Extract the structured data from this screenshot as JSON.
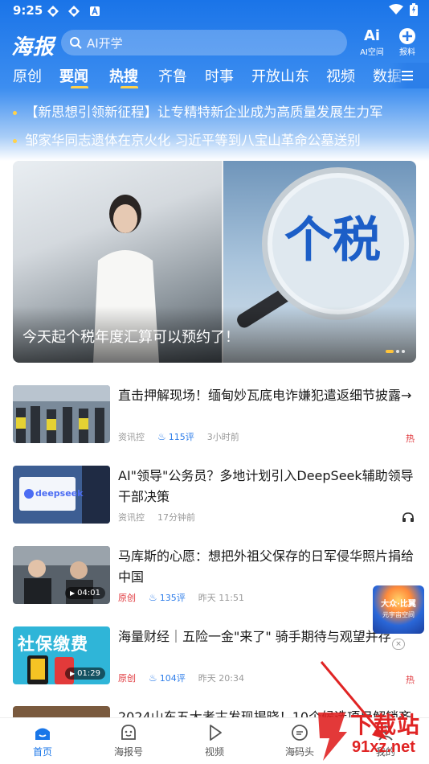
{
  "status": {
    "time": "9:25"
  },
  "topbar": {
    "logo": "海报",
    "search_text": "AI开学",
    "ai_space_label": "AI空间",
    "report_label": "报料",
    "ai_glyph": "Ai"
  },
  "tabs": [
    "原创",
    "要闻",
    "热搜",
    "齐鲁",
    "时事",
    "开放山东",
    "视频",
    "数据"
  ],
  "active_tab": "要闻",
  "headlines": [
    "【新思想引领新征程】让专精特新企业成为高质量发展生力军",
    "邹家华同志遗体在京火化 习近平等到八宝山革命公墓送别"
  ],
  "banner": {
    "lens_text": "个税",
    "caption": "今天起个税年度汇算可以预约了！"
  },
  "news": [
    {
      "title": "直击押解现场！缅甸妙瓦底电诈嫌犯遣返细节披露→",
      "source": "资讯控",
      "comments": "115评",
      "time": "3小时前",
      "tag": "热"
    },
    {
      "title": "AI\"领导\"公务员？多地计划引入DeepSeek辅助领导干部决策",
      "source": "资讯控",
      "time": "17分钟前",
      "thumb_text": "deepseek"
    },
    {
      "title": "马库斯的心愿：想把外祖父保存的日军侵华照片捐给中国",
      "source": "原创",
      "comments": "135评",
      "time": "昨天 11:51",
      "duration": "04:01"
    },
    {
      "title": "海量财经｜五险一金\"来了\" 骑手期待与观望并存",
      "source": "原创",
      "comments": "104评",
      "time": "昨天 20:34",
      "duration": "01:29",
      "tag": "热",
      "thumb_text": "社保缴费"
    }
  ],
  "partial_title": "2024山东五大考古发现揭晓！10个候选项目解锁齐",
  "float_ad": {
    "line1": "大众·比翼",
    "line2": "元宇宙空间"
  },
  "bottom_nav": [
    "首页",
    "海报号",
    "视频",
    "海码头",
    "我的"
  ],
  "watermark": {
    "line1": "下载站",
    "line2": "91xz.net"
  },
  "colors": {
    "brand_blue": "#1976e8",
    "accent_yellow": "#ffd24a",
    "hot_red": "#e0393e"
  }
}
